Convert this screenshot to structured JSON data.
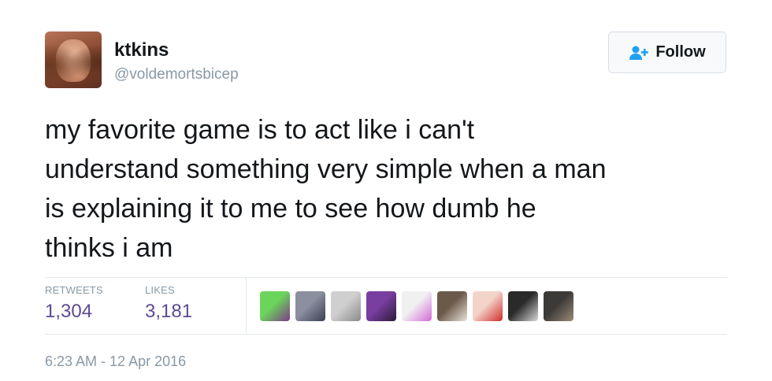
{
  "user": {
    "name": "ktkins",
    "handle": "@voldemortsbicep"
  },
  "follow_button": {
    "label": "Follow",
    "icon": "add-user-icon"
  },
  "tweet": {
    "text_lines": [
      "my favorite game is to act like i can't",
      "understand something very simple when a man",
      "is explaining it to me to see how dumb he",
      "thinks i am"
    ],
    "timestamp": "6:23 AM - 12 Apr 2016"
  },
  "stats": {
    "retweets_label": "RETWEETS",
    "retweets_value": "1,304",
    "likes_label": "LIKES",
    "likes_value": "3,181"
  },
  "likers": [
    {
      "colors": [
        "#6bd45a",
        "#7b3a8a"
      ]
    },
    {
      "colors": [
        "#8b8fa0",
        "#3b3f52"
      ]
    },
    {
      "colors": [
        "#cfcfcf",
        "#8a8a8a"
      ]
    },
    {
      "colors": [
        "#7a3ea0",
        "#2b1b3a"
      ]
    },
    {
      "colors": [
        "#f0f0f0",
        "#d46ad8"
      ]
    },
    {
      "colors": [
        "#6b5a4a",
        "#e9e2da"
      ]
    },
    {
      "colors": [
        "#f3d4c8",
        "#d12b2b"
      ]
    },
    {
      "colors": [
        "#2a2a2a",
        "#d9d9d9"
      ]
    },
    {
      "colors": [
        "#3c3a38",
        "#9a8a78"
      ]
    }
  ],
  "colors": {
    "stat_value": "#5e4a93",
    "muted": "#8899a6",
    "follow_icon": "#1da1f2"
  }
}
